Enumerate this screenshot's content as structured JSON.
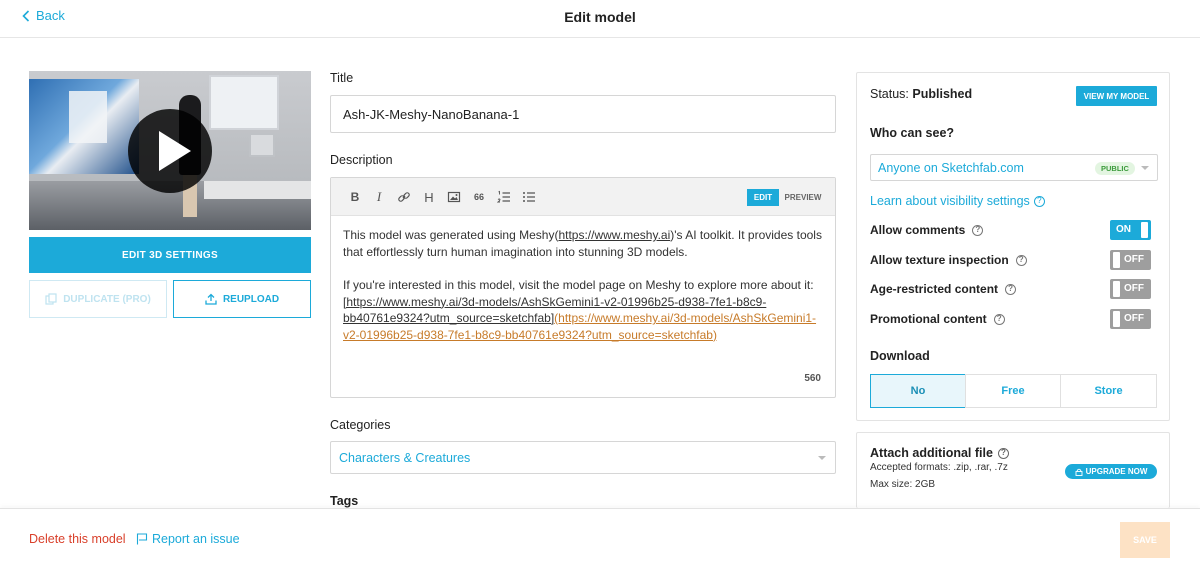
{
  "header": {
    "back_label": "Back",
    "page_title": "Edit model"
  },
  "left": {
    "edit_3d_label": "EDIT 3D SETTINGS",
    "duplicate_label": "DUPLICATE (PRO)",
    "reupload_label": "REUPLOAD"
  },
  "form": {
    "title_label": "Title",
    "title_value": "Ash-JK-Meshy-NanoBanana-1",
    "description_label": "Description",
    "editor_modes": {
      "edit": "EDIT",
      "preview": "PREVIEW"
    },
    "toolbar_icons": [
      "bold-icon",
      "italic-icon",
      "link-icon",
      "heading-icon",
      "image-icon",
      "quote-icon",
      "ordered-list-icon",
      "unordered-list-icon"
    ],
    "toolbar_glyphs": {
      "bold": "B",
      "italic": "I",
      "heading": "H",
      "quote": "66"
    },
    "description": {
      "p1_a": "This model was generated using Meshy(",
      "p1_link": "https://www.meshy.ai",
      "p1_b": ")'s AI toolkit. It provides tools that effortlessly turn human imagination into stunning 3D models.",
      "p2_a": "If you're interested in this model, visit the model page on Meshy to explore more about it: ",
      "p2_link_text": "[https://www.meshy.ai/3d-models/AshSkGemini1-v2-01996b25-d938-7fe1-b8c9-bb40761e9324?utm_source=sketchfab]",
      "p2_link_url": "(https://www.meshy.ai/3d-models/AshSkGemini1-v2-01996b25-d938-7fe1-b8c9-bb40761e9324?utm_source=sketchfab)"
    },
    "char_count": "560",
    "categories_label": "Categories",
    "categories_value": "Characters & Creatures",
    "tags_label": "Tags"
  },
  "sidebar": {
    "status_prefix": "Status: ",
    "status_value": "Published",
    "view_model_label": "VIEW MY MODEL",
    "who_can_see_label": "Who can see?",
    "visibility_value": "Anyone on Sketchfab.com",
    "visibility_badge": "PUBLIC",
    "learn_visibility": "Learn about visibility settings",
    "options": [
      {
        "label": "Allow comments",
        "state": "ON"
      },
      {
        "label": "Allow texture inspection",
        "state": "OFF"
      },
      {
        "label": "Age-restricted content",
        "state": "OFF"
      },
      {
        "label": "Promotional content",
        "state": "OFF"
      }
    ],
    "download_label": "Download",
    "download_options": [
      "No",
      "Free",
      "Store"
    ],
    "download_selected": "No",
    "attach_title": "Attach additional file",
    "attach_formats": "Accepted formats: .zip, .rar, .7z",
    "attach_max": "Max size: 2GB",
    "upgrade_label": "UPGRADE NOW"
  },
  "footer": {
    "delete_label": "Delete this model",
    "report_label": "Report an issue",
    "save_label": "SAVE"
  },
  "colors": {
    "accent": "#1caad9",
    "danger": "#d9402b",
    "link_orange": "#c77b2a",
    "save_disabled": "#fde2c5"
  },
  "help_glyph": "?"
}
